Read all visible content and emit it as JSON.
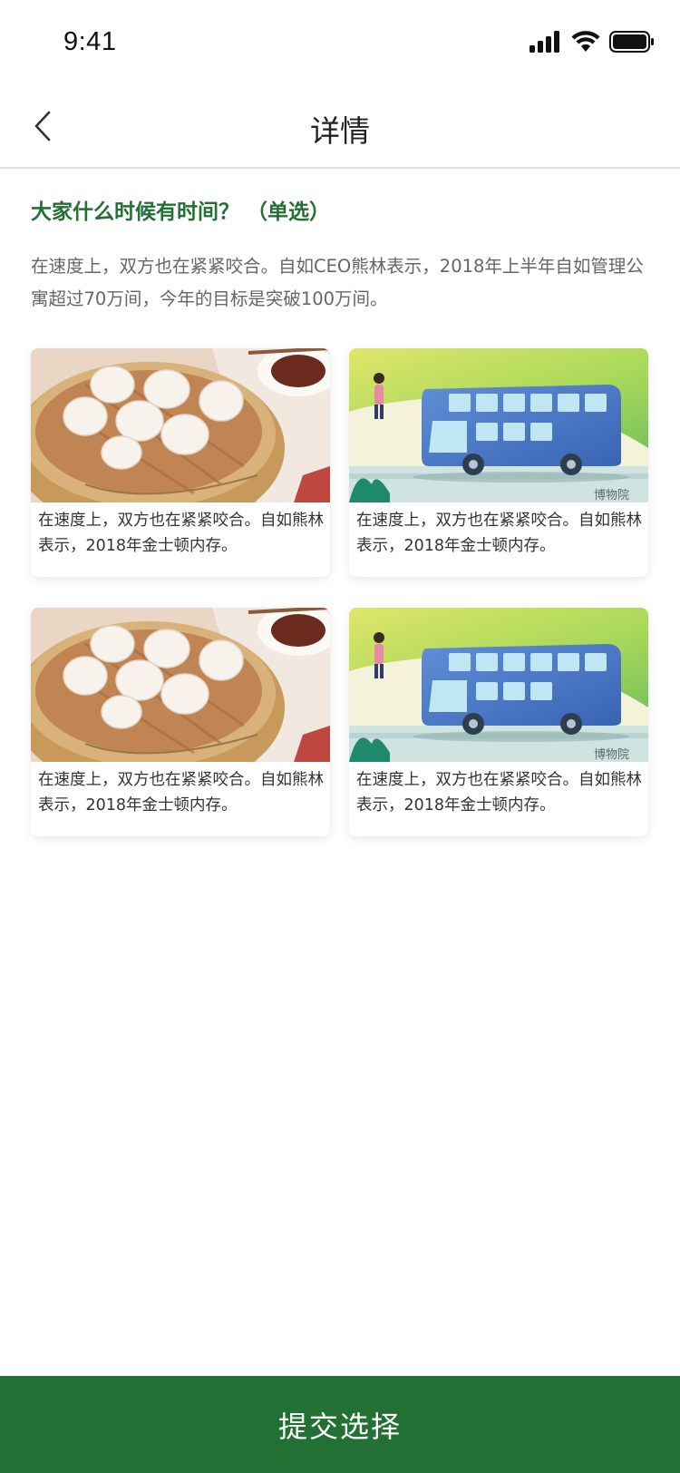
{
  "status_bar": {
    "time": "9:41"
  },
  "nav": {
    "title": "详情",
    "back_icon": "chevron-left-icon"
  },
  "question": {
    "title": "大家什么时候有时间？ （单选）",
    "description": "在速度上，双方也在紧紧咬合。自如CEO熊林表示，2018年上半年自如管理公寓超过70万间，今年的目标是突破100万间。"
  },
  "options": [
    {
      "image": "dumplings-illustration",
      "text": "在速度上，双方也在紧紧咬合。自如熊林表示，2018年金士顿内存。"
    },
    {
      "image": "bus-illustration",
      "image_caption": "博物院",
      "text": "在速度上，双方也在紧紧咬合。自如熊林表示，2018年金士顿内存。"
    },
    {
      "image": "dumplings-illustration",
      "text": "在速度上，双方也在紧紧咬合。自如熊林表示，2018年金士顿内存。"
    },
    {
      "image": "bus-illustration",
      "image_caption": "博物院",
      "text": "在速度上，双方也在紧紧咬合。自如熊林表示，2018年金士顿内存。"
    }
  ],
  "submit": {
    "label": "提交选择"
  },
  "colors": {
    "accent": "#237035",
    "divider": "#dfe5e3"
  }
}
